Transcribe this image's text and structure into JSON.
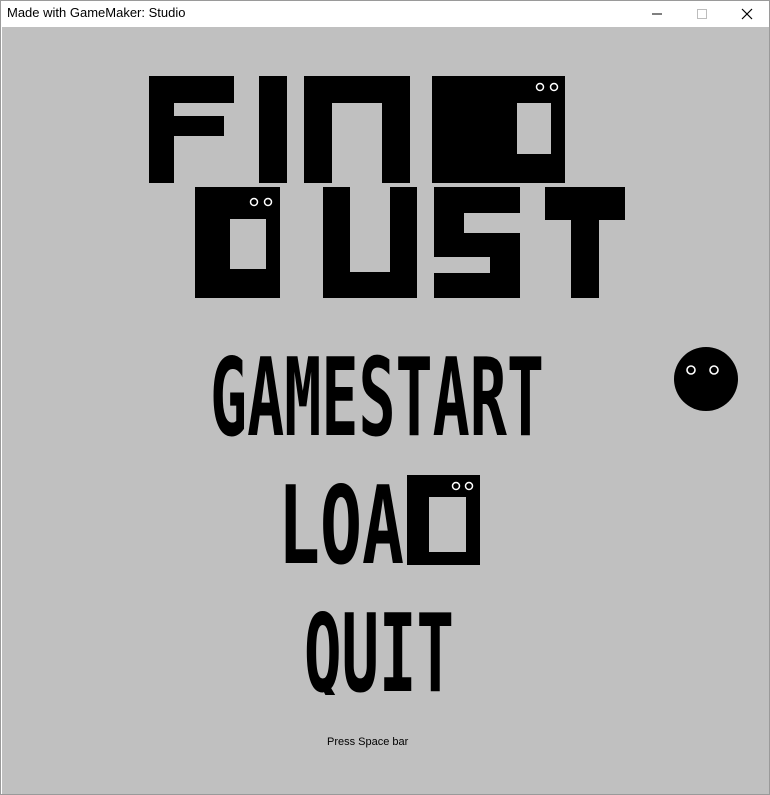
{
  "window": {
    "title": "Made with GameMaker: Studio",
    "controls": {
      "minimize": "minimize-icon",
      "maximize": "maximize-icon",
      "close": "close-icon"
    }
  },
  "game": {
    "background_color": "#c0c0c0",
    "logo": {
      "line1": "FIND",
      "line2": "DUST"
    },
    "menu": {
      "items": [
        {
          "label": "GAMESTART"
        },
        {
          "label": "LOAD"
        },
        {
          "label": "QUIT"
        }
      ]
    },
    "hint": "Press Space bar",
    "cursor_sprite": "dust-ball-icon"
  }
}
